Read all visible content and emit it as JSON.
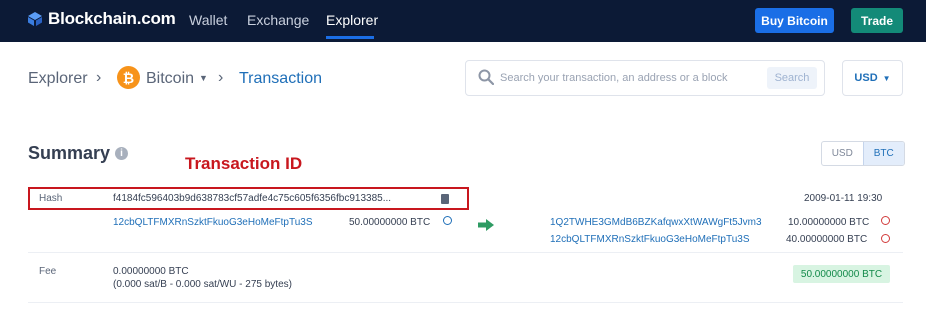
{
  "nav": {
    "brand": "Blockchain.com",
    "links": [
      "Wallet",
      "Exchange",
      "Explorer"
    ],
    "buy_label": "Buy Bitcoin",
    "trade_label": "Trade"
  },
  "breadcrumb": {
    "root": "Explorer",
    "coin": "Bitcoin",
    "coin_symbol": "₿",
    "current": "Transaction"
  },
  "search": {
    "placeholder": "Search your transaction, an address or a block",
    "button_label": "Search"
  },
  "currency_select": {
    "value": "USD"
  },
  "summary": {
    "title": "Summary",
    "annotation": "Transaction ID",
    "toggle": [
      "USD",
      "BTC"
    ],
    "toggle_selected": "BTC"
  },
  "transaction": {
    "hash_label": "Hash",
    "hash_value": "f4184fc596403b9d638783cf57adfe4c75c605f6356fbc913385...",
    "timestamp": "2009-01-11 19:30",
    "input_address": "12cbQLTFMXRnSzktFkuoG3eHoMeFtpTu3S",
    "input_amount": "50.00000000 BTC",
    "outputs": [
      {
        "address": "1Q2TWHE3GMdB6BZKafqwxXtWAWgFt5Jvm3",
        "amount": "10.00000000 BTC"
      },
      {
        "address": "12cbQLTFMXRnSzktFkuoG3eHoMeFtpTu3S",
        "amount": "40.00000000 BTC"
      }
    ],
    "fee_label": "Fee",
    "fee_value": "0.00000000 BTC",
    "fee_detail": "(0.000 sat/B - 0.000 sat/WU - 275 bytes)",
    "total": "50.00000000 BTC"
  },
  "colors": {
    "nav_bg": "#0c1a36",
    "accent_blue": "#1a6ee6",
    "trade_green": "#138a78",
    "annotation_red": "#c8171e",
    "bitcoin_orange": "#f7931a"
  }
}
